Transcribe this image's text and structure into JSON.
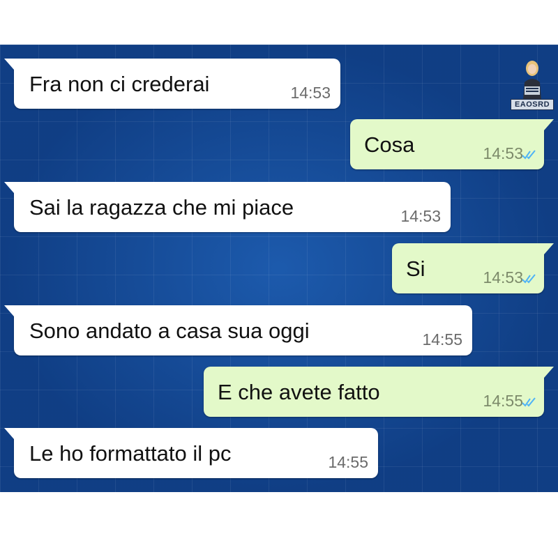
{
  "watermark": {
    "label": "EAOSRD",
    "icon": "avatar-figure-icon"
  },
  "conversation": {
    "messages": [
      {
        "direction": "in",
        "text": "Fra non ci crederai",
        "time": "14:53"
      },
      {
        "direction": "out",
        "text": "Cosa",
        "time": "14:53",
        "status": "read-double-check-icon"
      },
      {
        "direction": "in",
        "text": "Sai la ragazza che mi piace",
        "time": "14:53"
      },
      {
        "direction": "out",
        "text": "Si",
        "time": "14:53",
        "status": "read-double-check-icon"
      },
      {
        "direction": "in",
        "text": "Sono andato a casa sua oggi",
        "time": "14:55"
      },
      {
        "direction": "out",
        "text": "E che avete fatto",
        "time": "14:55",
        "status": "read-double-check-icon"
      },
      {
        "direction": "in",
        "text": "Le ho formattato il pc",
        "time": "14:55"
      }
    ]
  },
  "colors": {
    "chat_background": "#134a96",
    "incoming_bubble": "#ffffff",
    "outgoing_bubble": "#e3f9c9",
    "read_ticks": "#4fb3f6"
  }
}
